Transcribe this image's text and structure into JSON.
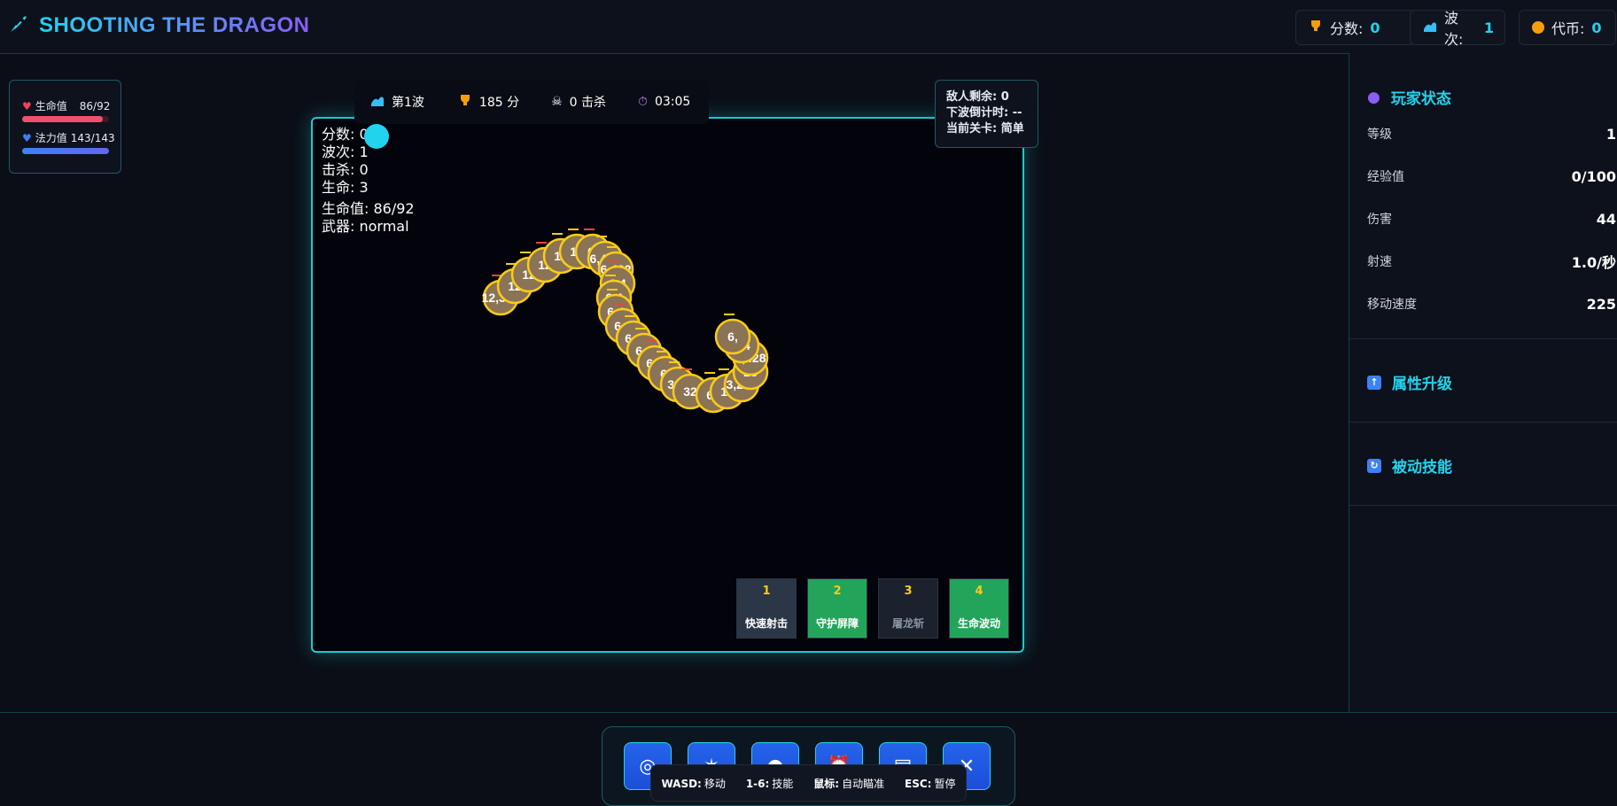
{
  "header": {
    "title": "SHOOTING THE DRAGON",
    "stats": [
      {
        "label": "分数:",
        "value": "0"
      },
      {
        "label": "波次:",
        "value": "1"
      },
      {
        "label": "代币:",
        "value": "0"
      }
    ]
  },
  "player_bars": {
    "hp_label": "生命值",
    "hp_value": "86/92",
    "hp_fraction": 0.93,
    "mp_label": "法力值",
    "mp_value": "143/143",
    "mp_fraction": 1.0
  },
  "hud_strip": {
    "wave": "第1波",
    "score": "185 分",
    "kills": "0 击杀",
    "time": "03:05"
  },
  "wave_info": {
    "enemies": "敌人剩余: 0",
    "countdown": "下波倒计时: --",
    "level": "当前关卡: 简单"
  },
  "canvas_hud": {
    "score": "分数: 0",
    "wave": "波次: 1",
    "kills": "击杀: 0",
    "lives": "生命: 3",
    "hp": "生命值: 86/92",
    "weapon": "武器: normal"
  },
  "dragon_labels": [
    "12,360",
    "12",
    "12",
    "12",
    "12",
    "12",
    "6,",
    "6,432",
    "6,432",
    "6,4",
    "6,4",
    "6,4",
    "6,4",
    "6,4",
    "6,4",
    "6,4",
    "6,",
    "336",
    "32",
    "61",
    "10",
    "3,213",
    "28",
    "6,428",
    "6,4",
    "6,"
  ],
  "skills": [
    {
      "key": "1",
      "name": "快速射击",
      "color": "#2b3647"
    },
    {
      "key": "2",
      "name": "守护屏障",
      "color": "#22a55b"
    },
    {
      "key": "3",
      "name": "屠龙斩",
      "color": "#1c222d"
    },
    {
      "key": "4",
      "name": "生命波动",
      "color": "#22a55b"
    }
  ],
  "sidebar": {
    "player_title": "玩家状态",
    "rows": [
      {
        "label": "等级",
        "value": "1"
      },
      {
        "label": "经验值",
        "value": "0/100"
      },
      {
        "label": "伤害",
        "value": "44"
      },
      {
        "label": "射速",
        "value": "1.0/秒"
      },
      {
        "label": "移动速度",
        "value": "225"
      }
    ],
    "upgrade_title": "属性升级",
    "passive_title": "被动技能"
  },
  "dock": {
    "buttons": [
      "target-icon",
      "dragon-icon",
      "globe-icon",
      "alarm-icon",
      "news-icon",
      "swords-icon"
    ]
  },
  "keys": [
    {
      "key": "WASD:",
      "desc": "移动"
    },
    {
      "key": "1-6:",
      "desc": "技能"
    },
    {
      "key": "鼠标:",
      "desc": "自动瞄准"
    },
    {
      "key": "ESC:",
      "desc": "暂停"
    }
  ]
}
